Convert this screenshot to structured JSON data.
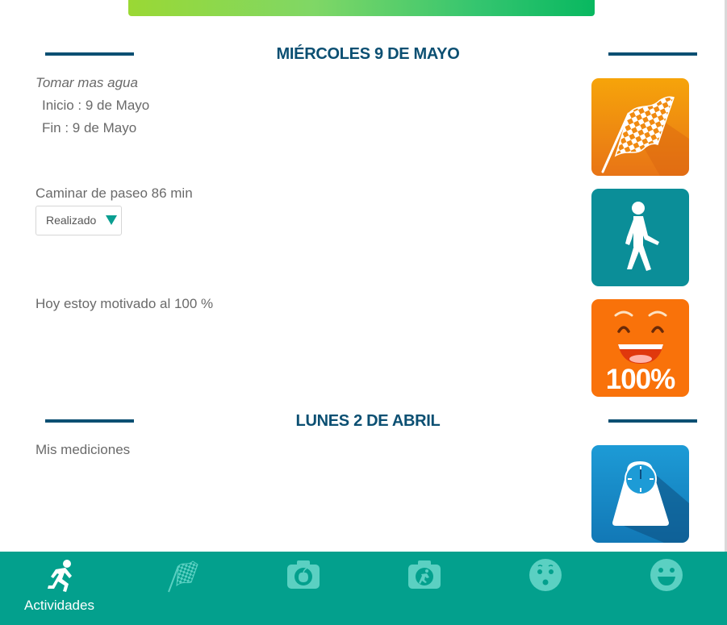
{
  "days": [
    {
      "title": "MIÉRCOLES 9 DE MAYO"
    },
    {
      "title": "LUNES 2 DE ABRIL"
    }
  ],
  "activities": {
    "goal": {
      "name": "Tomar mas agua",
      "start": "Inicio : 9 de Mayo",
      "end": "Fin : 9 de Mayo",
      "icon": "checkered-flag-icon"
    },
    "walk": {
      "name": "Caminar de paseo 86 min",
      "status": "Realizado",
      "icon": "walking-person-icon"
    },
    "mood": {
      "name": "Hoy estoy motivado al 100 %",
      "percent_label": "100%",
      "icon": "happy-face-icon"
    },
    "measure": {
      "name": "Mis mediciones",
      "icon": "scale-icon"
    }
  },
  "nav": {
    "items": [
      {
        "label": "Actividades",
        "icon": "running-person-icon",
        "active": true
      },
      {
        "icon": "checkered-flag-icon"
      },
      {
        "icon": "camera-food-icon"
      },
      {
        "icon": "camera-activity-icon"
      },
      {
        "icon": "surprised-face-icon"
      },
      {
        "icon": "happy-face-icon"
      }
    ]
  },
  "colors": {
    "heading": "#0b4f72",
    "nav_background": "#03a08d",
    "goal_tile": "#f08a10",
    "walk_tile": "#0b8e98",
    "mood_tile": "#f9720a",
    "scale_tile": "#1888c8"
  }
}
